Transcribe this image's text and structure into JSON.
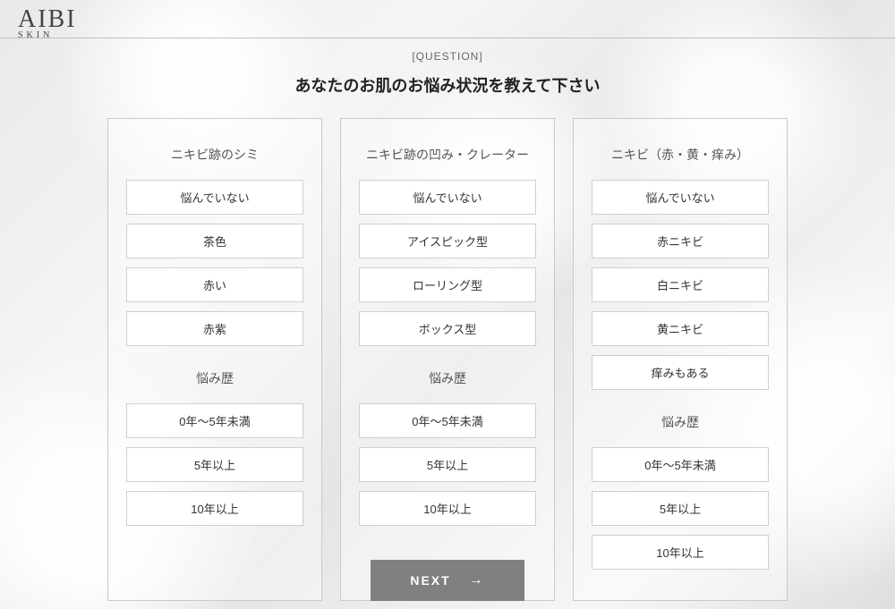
{
  "brand": {
    "main": "AIBI",
    "sub": "SKIN"
  },
  "question_label": "[QUESTION]",
  "title": "あなたのお肌のお悩み状況を教えて下さい",
  "columns": [
    {
      "heading": "ニキビ跡のシミ",
      "options": [
        "悩んでいない",
        "茶色",
        "赤い",
        "赤紫"
      ],
      "history_heading": "悩み歴",
      "history_options": [
        "0年〜5年未満",
        "5年以上",
        "10年以上"
      ]
    },
    {
      "heading": "ニキビ跡の凹み・クレーター",
      "options": [
        "悩んでいない",
        "アイスピック型",
        "ローリング型",
        "ボックス型"
      ],
      "history_heading": "悩み歴",
      "history_options": [
        "0年〜5年未満",
        "5年以上",
        "10年以上"
      ]
    },
    {
      "heading": "ニキビ（赤・黄・痒み）",
      "options": [
        "悩んでいない",
        "赤ニキビ",
        "白ニキビ",
        "黄ニキビ",
        "痒みもある"
      ],
      "history_heading": "悩み歴",
      "history_options": [
        "0年〜5年未満",
        "5年以上",
        "10年以上"
      ]
    }
  ],
  "next_label": "NEXT",
  "next_arrow": "→"
}
